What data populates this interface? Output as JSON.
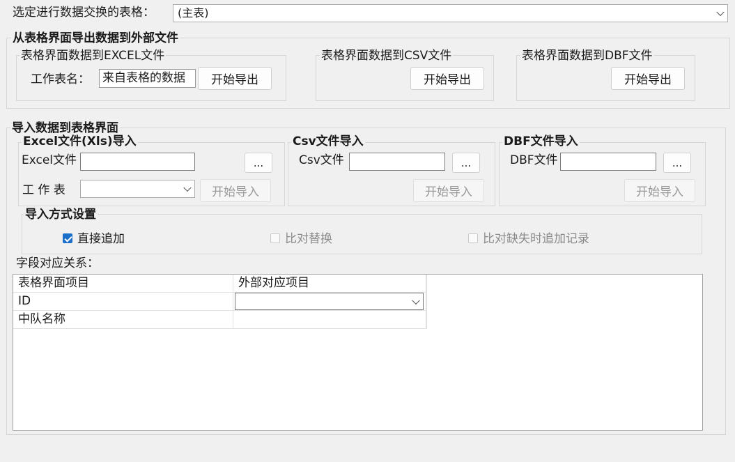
{
  "top": {
    "label": "选定进行数据交换的表格：",
    "table_select_value": "(主表)"
  },
  "export": {
    "title": "从表格界面导出数据到外部文件",
    "excel": {
      "title": "表格界面数据到EXCEL文件",
      "sheet_label": "工作表名：",
      "sheet_value": "来自表格的数据",
      "button": "开始导出"
    },
    "csv": {
      "title": "表格界面数据到CSV文件",
      "button": "开始导出"
    },
    "dbf": {
      "title": "表格界面数据到DBF文件",
      "button": "开始导出"
    }
  },
  "import": {
    "title": "导入数据到表格界面",
    "excel": {
      "title": "Excel文件(Xls)导入",
      "file_label": "Excel文件",
      "file_value": "",
      "browse": "...",
      "sheet_label": "工 作 表",
      "sheet_value": "",
      "button": "开始导入"
    },
    "csv": {
      "title": "Csv文件导入",
      "file_label": "Csv文件",
      "file_value": "",
      "browse": "...",
      "button": "开始导入"
    },
    "dbf": {
      "title": "DBF文件导入",
      "file_label": "DBF文件",
      "file_value": "",
      "browse": "...",
      "button": "开始导入"
    },
    "mode": {
      "title": "导入方式设置",
      "options": [
        {
          "label": "直接追加",
          "checked": true,
          "enabled": true
        },
        {
          "label": "比对替换",
          "checked": false,
          "enabled": false
        },
        {
          "label": "比对缺失时追加记录",
          "checked": false,
          "enabled": false
        }
      ]
    }
  },
  "mapping": {
    "label": "字段对应关系：",
    "headers": [
      "表格界面项目",
      "外部对应项目"
    ],
    "rows": [
      {
        "field": "ID",
        "external": ""
      },
      {
        "field": "中队名称",
        "external": ""
      }
    ]
  },
  "colors": {
    "accent": "#1c6fc8",
    "background": "#f0f0f0"
  }
}
